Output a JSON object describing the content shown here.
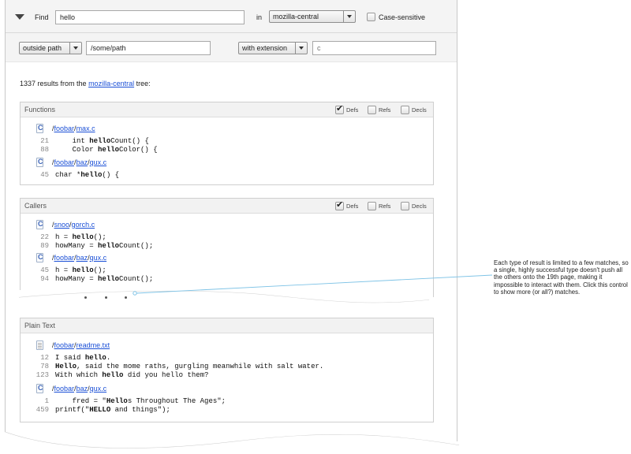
{
  "search": {
    "find_label": "Find",
    "query": "hello",
    "in_label": "in",
    "tree": "mozilla-central",
    "case_sensitive_label": "Case-sensitive",
    "case_sensitive_checked": false
  },
  "filters": {
    "path_mode": "outside path",
    "path_value": "/some/path",
    "ext_mode": "with extension",
    "ext_placeholder": "c"
  },
  "summary": {
    "prefix": "1337 results from the",
    "tree": "mozilla-central",
    "suffix": "tree:"
  },
  "panels": [
    {
      "title": "Functions",
      "options": [
        {
          "label": "Defs",
          "checked": true
        },
        {
          "label": "Refs",
          "checked": false
        },
        {
          "label": "Decls",
          "checked": false
        }
      ],
      "files": [
        {
          "icon": "c-file-icon",
          "path_parts": [
            "/",
            "foobar",
            "/",
            "max.c"
          ],
          "lines": [
            {
              "num": "21",
              "before": "    int ",
              "match": "hello",
              "after": "Count() {"
            },
            {
              "num": "88",
              "before": "    Color ",
              "match": "hello",
              "after": "Color() {"
            }
          ]
        },
        {
          "icon": "c-file-icon",
          "path_parts": [
            "/",
            "foobar",
            "/",
            "baz",
            "/",
            "qux.c"
          ],
          "lines": [
            {
              "num": "45",
              "before": "char *",
              "match": "hello",
              "after": "() {"
            }
          ]
        }
      ]
    },
    {
      "title": "Callers",
      "options": [
        {
          "label": "Defs",
          "checked": true
        },
        {
          "label": "Refs",
          "checked": false
        },
        {
          "label": "Decls",
          "checked": false
        }
      ],
      "files": [
        {
          "icon": "c-file-icon",
          "path_parts": [
            "/",
            "snoo",
            "/",
            "gorch.c"
          ],
          "lines": [
            {
              "num": "22",
              "before": "h = ",
              "match": "hello",
              "after": "();"
            },
            {
              "num": "89",
              "before": "howMany = ",
              "match": "hello",
              "after": "Count();"
            }
          ]
        },
        {
          "icon": "c-file-icon",
          "path_parts": [
            "/",
            "foobar",
            "/",
            "baz",
            "/",
            "qux.c"
          ],
          "lines": [
            {
              "num": "45",
              "before": "h = ",
              "match": "hello",
              "after": "();"
            },
            {
              "num": "94",
              "before": "howMany = ",
              "match": "hello",
              "after": "Count();"
            }
          ]
        }
      ]
    },
    {
      "title": "Plain Text",
      "files": [
        {
          "icon": "text-file-icon",
          "path_parts": [
            "/",
            "foobar",
            "/",
            "readme.txt"
          ],
          "lines": [
            {
              "num": "12",
              "before": "I said ",
              "match": "hello",
              "after": "."
            },
            {
              "num": "78",
              "before": "",
              "match": "Hello",
              "after": ", said the mome raths, gurgling meanwhile with salt water."
            },
            {
              "num": "123",
              "before": "With which ",
              "match": "hello",
              "after": " did you hello them?"
            }
          ]
        },
        {
          "icon": "c-file-icon",
          "path_parts": [
            "/",
            "foobar",
            "/",
            "baz",
            "/",
            "qux.c"
          ],
          "lines": [
            {
              "num": "1",
              "before": "    fred = \"",
              "match": "Hello",
              "after": "s Throughout The Ages\";"
            },
            {
              "num": "459",
              "before": "printf(\"",
              "match": "HELLO",
              "after": " and things\");"
            }
          ]
        }
      ]
    }
  ],
  "annotation": "Each type of result is limited to a few matches, so a single, highly successful type doesn't push all the others onto the 19th page, making it impossible to interact with them. Click this control to show more (or all?) matches.",
  "colors": {
    "link": "#1a4fd6",
    "annotation_line": "#7ec3e6"
  }
}
